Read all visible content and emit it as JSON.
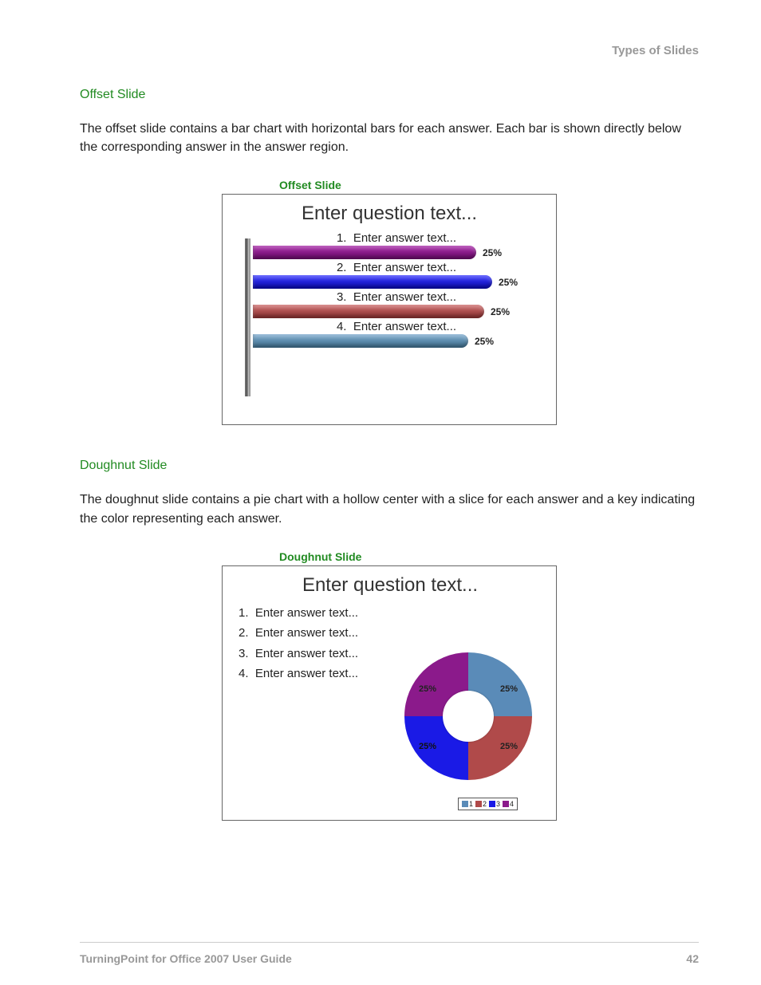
{
  "header": {
    "section": "Types of Slides"
  },
  "sections": {
    "offset": {
      "heading": "Offset Slide",
      "body": "The offset slide contains a bar chart with horizontal bars for each answer. Each bar is shown directly below the corresponding answer in the answer region.",
      "caption": "Offset Slide",
      "slide": {
        "title": "Enter question text...",
        "answers": [
          {
            "num": "1.",
            "text": "Enter answer text...",
            "pct": "25%"
          },
          {
            "num": "2.",
            "text": "Enter answer text...",
            "pct": "25%"
          },
          {
            "num": "3.",
            "text": "Enter answer text...",
            "pct": "25%"
          },
          {
            "num": "4.",
            "text": "Enter answer text...",
            "pct": "25%"
          }
        ]
      }
    },
    "doughnut": {
      "heading": "Doughnut Slide",
      "body": "The doughnut slide contains a pie chart with a hollow center with a slice for each answer and a key indicating the color representing each answer.",
      "caption": "Doughnut Slide",
      "slide": {
        "title": "Enter question text...",
        "answers": [
          {
            "num": "1.",
            "text": "Enter answer text..."
          },
          {
            "num": "2.",
            "text": "Enter answer text..."
          },
          {
            "num": "3.",
            "text": "Enter answer text..."
          },
          {
            "num": "4.",
            "text": "Enter answer text..."
          }
        ],
        "slices": [
          {
            "label": "25%"
          },
          {
            "label": "25%"
          },
          {
            "label": "25%"
          },
          {
            "label": "25%"
          }
        ],
        "legend": [
          {
            "n": "1"
          },
          {
            "n": "2"
          },
          {
            "n": "3"
          },
          {
            "n": "4"
          }
        ]
      }
    }
  },
  "footer": {
    "doc": "TurningPoint for Office 2007 User Guide",
    "page": "42"
  },
  "colors": {
    "bar1": "#8B1A8B",
    "bar2": "#1A1AE6",
    "bar3": "#B04A4A",
    "bar4": "#5A8BB8",
    "slice_tr": "#5A8BB8",
    "slice_br": "#B04A4A",
    "slice_bl": "#1A1AE6",
    "slice_tl": "#8B1A8B"
  },
  "chart_data": [
    {
      "type": "bar",
      "title": "Enter question text...",
      "orientation": "horizontal",
      "categories": [
        "1. Enter answer text...",
        "2. Enter answer text...",
        "3. Enter answer text...",
        "4. Enter answer text..."
      ],
      "values": [
        25,
        25,
        25,
        25
      ],
      "unit": "%",
      "colors": [
        "#8B1A8B",
        "#1A1AE6",
        "#B04A4A",
        "#5A8BB8"
      ]
    },
    {
      "type": "pie",
      "variant": "doughnut",
      "title": "Enter question text...",
      "categories": [
        "1",
        "2",
        "3",
        "4"
      ],
      "values": [
        25,
        25,
        25,
        25
      ],
      "unit": "%",
      "colors": [
        "#5A8BB8",
        "#B04A4A",
        "#1A1AE6",
        "#8B1A8B"
      ]
    }
  ]
}
